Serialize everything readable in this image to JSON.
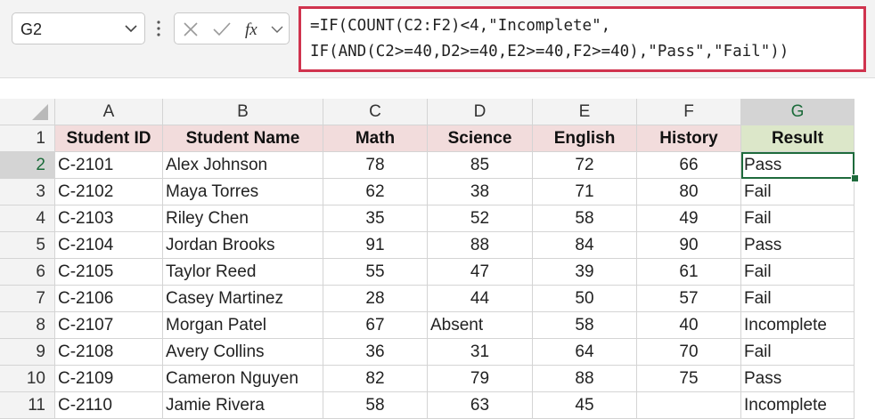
{
  "formula_bar": {
    "name_box": "G2",
    "formula_line1": "=IF(COUNT(C2:F2)<4,\"Incomplete\",",
    "formula_line2": "IF(AND(C2>=40,D2>=40,E2>=40,F2>=40),\"Pass\",\"Fail\"))",
    "icons": [
      "chevron-down-icon",
      "more-options-icon",
      "cancel-icon",
      "enter-icon",
      "insert-function-icon",
      "chevron-down-icon"
    ],
    "highlight_color": "#d0334e"
  },
  "sheet": {
    "column_letters": [
      "A",
      "B",
      "C",
      "D",
      "E",
      "F",
      "G"
    ],
    "row_numbers": [
      "1",
      "2",
      "3",
      "4",
      "5",
      "6",
      "7",
      "8",
      "9",
      "10",
      "11"
    ],
    "headers": [
      "Student ID",
      "Student Name",
      "Math",
      "Science",
      "English",
      "History",
      "Result"
    ],
    "rows": [
      [
        "C-2101",
        "Alex Johnson",
        "78",
        "85",
        "72",
        "66",
        "Pass"
      ],
      [
        "C-2102",
        "Maya Torres",
        "62",
        "38",
        "71",
        "80",
        "Fail"
      ],
      [
        "C-2103",
        "Riley Chen",
        "35",
        "52",
        "58",
        "49",
        "Fail"
      ],
      [
        "C-2104",
        "Jordan Brooks",
        "91",
        "88",
        "84",
        "90",
        "Pass"
      ],
      [
        "C-2105",
        "Taylor Reed",
        "55",
        "47",
        "39",
        "61",
        "Fail"
      ],
      [
        "C-2106",
        "Casey Martinez",
        "28",
        "44",
        "50",
        "57",
        "Fail"
      ],
      [
        "C-2107",
        "Morgan Patel",
        "67",
        "Absent",
        "58",
        "40",
        "Incomplete"
      ],
      [
        "C-2108",
        "Avery Collins",
        "36",
        "31",
        "64",
        "70",
        "Fail"
      ],
      [
        "C-2109",
        "Cameron Nguyen",
        "82",
        "79",
        "88",
        "75",
        "Pass"
      ],
      [
        "C-2110",
        "Jamie Rivera",
        "58",
        "63",
        "45",
        "",
        "Incomplete"
      ]
    ],
    "active_cell": "G2",
    "colors": {
      "header_fill": "#f2dcdc",
      "result_header_fill": "#dce7c9",
      "selection": "#1e6b3c"
    }
  }
}
